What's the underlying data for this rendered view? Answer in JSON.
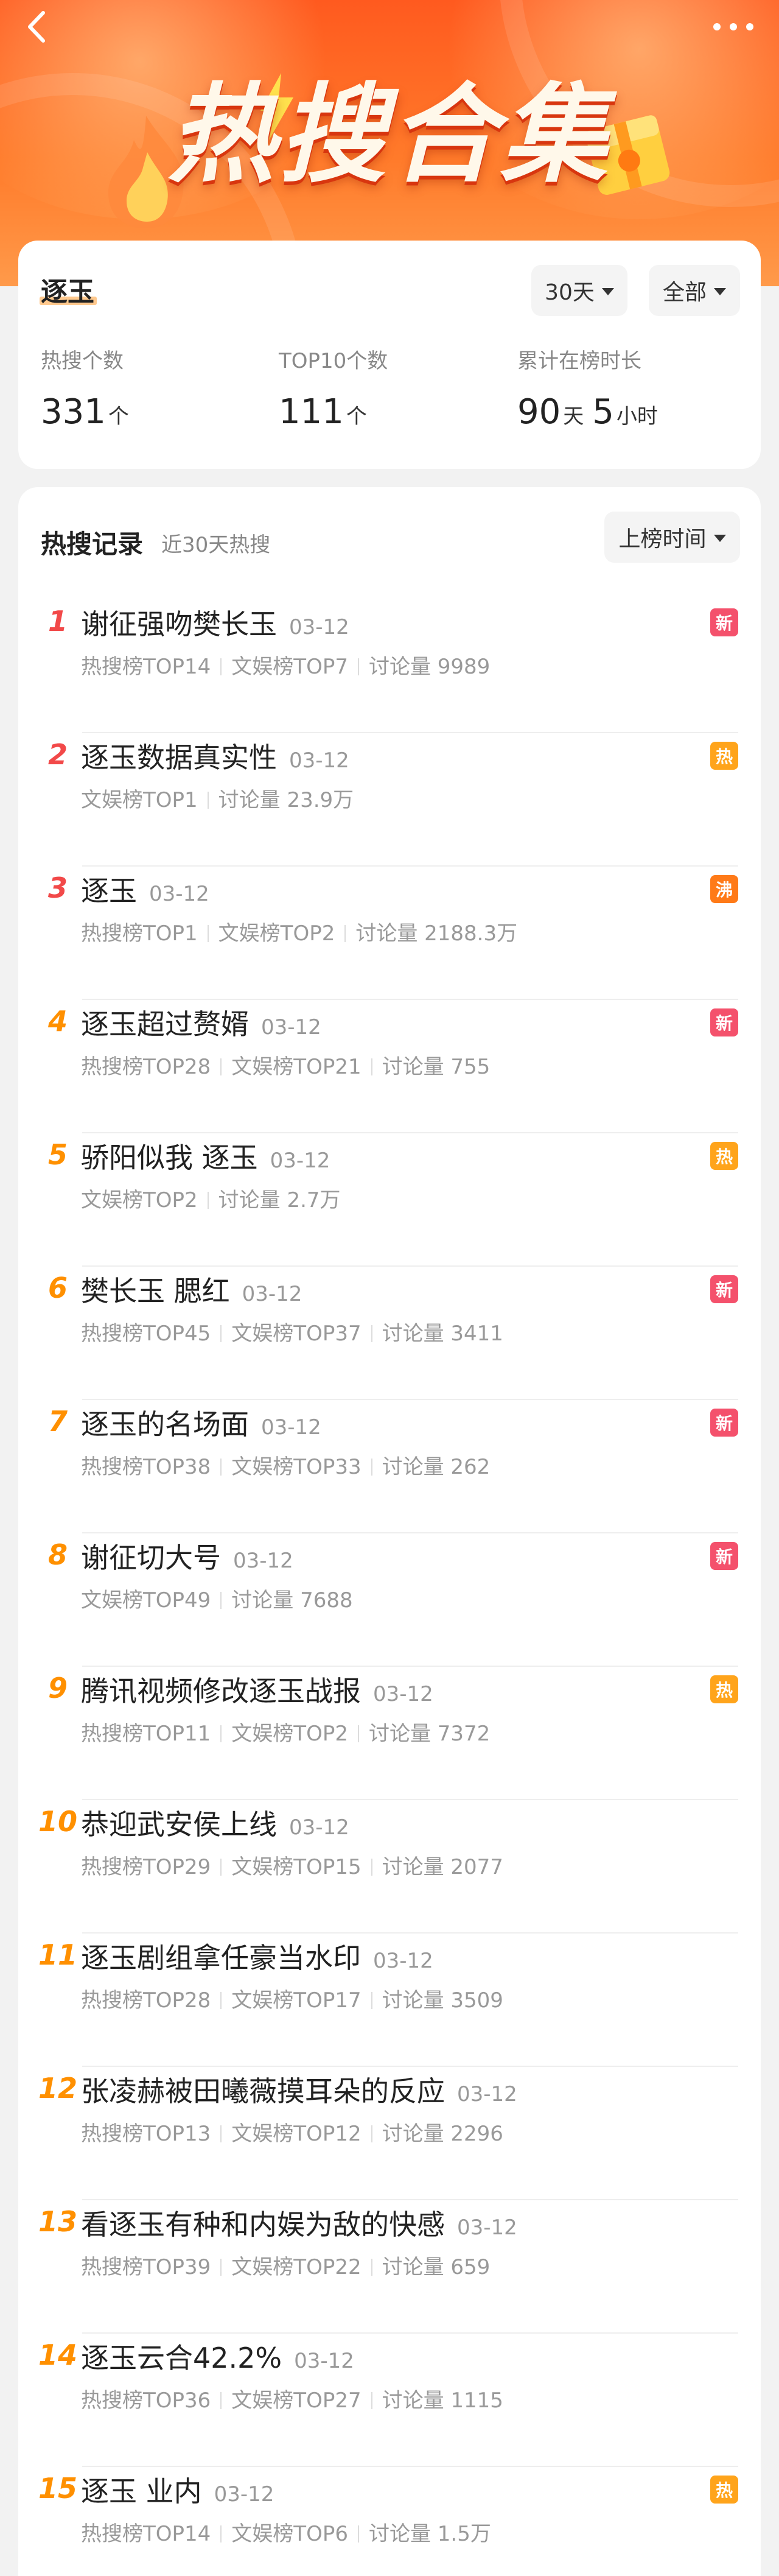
{
  "header": {
    "title": "热搜合集",
    "accent": "#ff6a22"
  },
  "summary": {
    "topic": "逐玉",
    "filter_period": "30天",
    "filter_scope": "全部",
    "stats": [
      {
        "label": "热搜个数",
        "value": "331",
        "unit": "个"
      },
      {
        "label": "TOP10个数",
        "value": "111",
        "unit": "个"
      },
      {
        "label": "累计在榜时长",
        "value": "90",
        "unit": "天",
        "value2": "5",
        "unit2": "小时"
      }
    ]
  },
  "records": {
    "title": "热搜记录",
    "subtitle": "近30天热搜",
    "sort_label": "上榜时间",
    "badge_colors": {
      "新": "#f4516c",
      "热": "#ffa41b",
      "沸": "#ff7a18"
    },
    "items": [
      {
        "rank": "1",
        "title": "谢征强吻樊长玉",
        "date": "03-12",
        "meta": [
          "热搜榜TOP14",
          "文娱榜TOP7",
          "讨论量 9989"
        ],
        "badge": "新"
      },
      {
        "rank": "2",
        "title": "逐玉数据真实性",
        "date": "03-12",
        "meta": [
          "文娱榜TOP1",
          "讨论量 23.9万"
        ],
        "badge": "热"
      },
      {
        "rank": "3",
        "title": "逐玉",
        "date": "03-12",
        "meta": [
          "热搜榜TOP1",
          "文娱榜TOP2",
          "讨论量 2188.3万"
        ],
        "badge": "沸"
      },
      {
        "rank": "4",
        "title": "逐玉超过赘婿",
        "date": "03-12",
        "meta": [
          "热搜榜TOP28",
          "文娱榜TOP21",
          "讨论量 755"
        ],
        "badge": "新"
      },
      {
        "rank": "5",
        "title": "骄阳似我 逐玉",
        "date": "03-12",
        "meta": [
          "文娱榜TOP2",
          "讨论量 2.7万"
        ],
        "badge": "热"
      },
      {
        "rank": "6",
        "title": "樊长玉 腮红",
        "date": "03-12",
        "meta": [
          "热搜榜TOP45",
          "文娱榜TOP37",
          "讨论量 3411"
        ],
        "badge": "新"
      },
      {
        "rank": "7",
        "title": "逐玉的名场面",
        "date": "03-12",
        "meta": [
          "热搜榜TOP38",
          "文娱榜TOP33",
          "讨论量 262"
        ],
        "badge": "新"
      },
      {
        "rank": "8",
        "title": "谢征切大号",
        "date": "03-12",
        "meta": [
          "文娱榜TOP49",
          "讨论量 7688"
        ],
        "badge": "新"
      },
      {
        "rank": "9",
        "title": "腾讯视频修改逐玉战报",
        "date": "03-12",
        "meta": [
          "热搜榜TOP11",
          "文娱榜TOP2",
          "讨论量 7372"
        ],
        "badge": "热"
      },
      {
        "rank": "10",
        "title": "恭迎武安侯上线",
        "date": "03-12",
        "meta": [
          "热搜榜TOP29",
          "文娱榜TOP15",
          "讨论量 2077"
        ],
        "badge": ""
      },
      {
        "rank": "11",
        "title": "逐玉剧组拿任豪当水印",
        "date": "03-12",
        "meta": [
          "热搜榜TOP28",
          "文娱榜TOP17",
          "讨论量 3509"
        ],
        "badge": ""
      },
      {
        "rank": "12",
        "title": "张凌赫被田曦薇摸耳朵的反应",
        "date": "03-12",
        "meta": [
          "热搜榜TOP13",
          "文娱榜TOP12",
          "讨论量 2296"
        ],
        "badge": ""
      },
      {
        "rank": "13",
        "title": "看逐玉有种和内娱为敌的快感",
        "date": "03-12",
        "meta": [
          "热搜榜TOP39",
          "文娱榜TOP22",
          "讨论量 659"
        ],
        "badge": ""
      },
      {
        "rank": "14",
        "title": "逐玉云合42.2%",
        "date": "03-12",
        "meta": [
          "热搜榜TOP36",
          "文娱榜TOP27",
          "讨论量 1115"
        ],
        "badge": ""
      },
      {
        "rank": "15",
        "title": "逐玉 业内",
        "date": "03-12",
        "meta": [
          "热搜榜TOP14",
          "文娱榜TOP6",
          "讨论量 1.5万"
        ],
        "badge": "热"
      }
    ]
  }
}
